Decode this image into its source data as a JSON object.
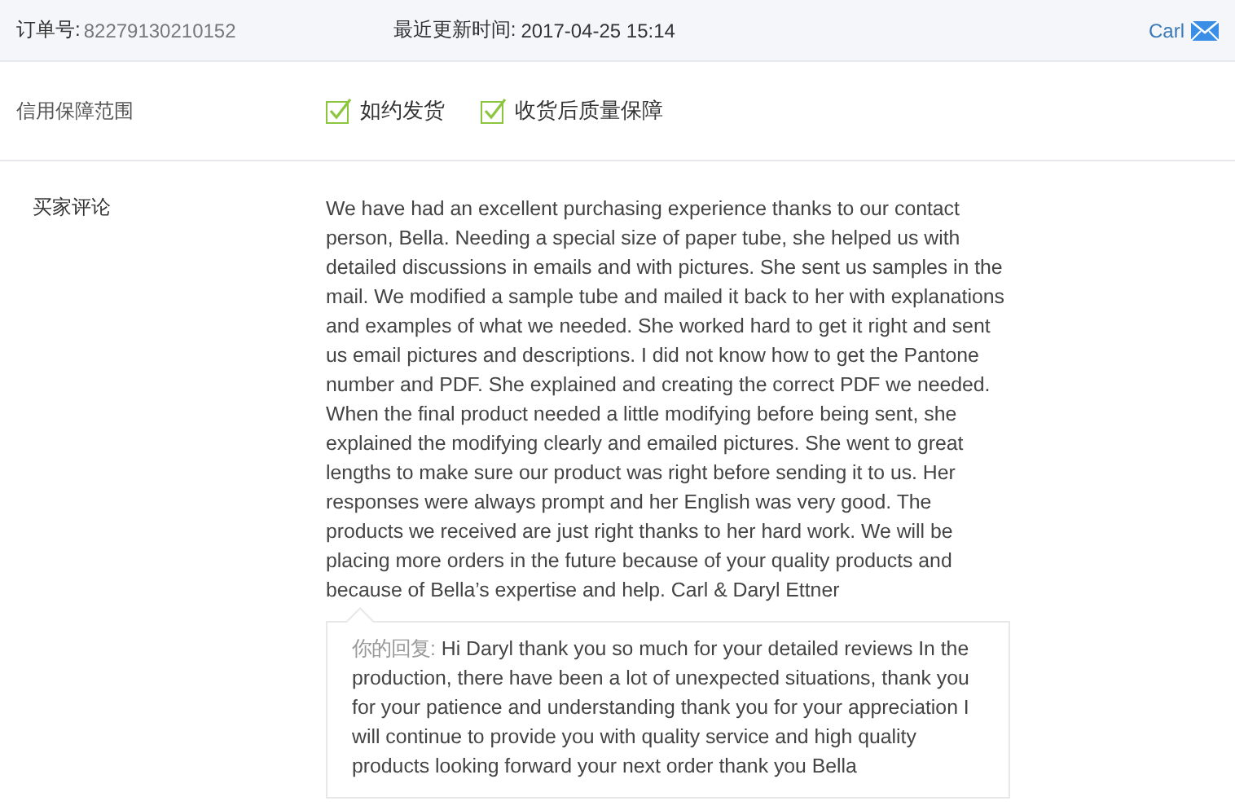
{
  "order_bar": {
    "order_label": "订单号:",
    "order_number": "82279130210152",
    "updated_label": "最近更新时间:",
    "updated_time": "2017-04-25 15:14",
    "contact": "Carl"
  },
  "guarantee": {
    "label": "信用保障范围",
    "items": [
      {
        "label": "如约发货",
        "checked": true
      },
      {
        "label": "收货后质量保障",
        "checked": true
      }
    ]
  },
  "review": {
    "label": "买家评论",
    "text": "We have had an excellent purchasing experience thanks to our contact person, Bella. Needing a special size of paper tube, she helped us with detailed discussions in emails and with pictures. She sent us samples in the mail. We modified a sample tube and mailed it back to her with explanations and examples of what we needed. She worked hard to get it right and sent us email pictures and descriptions. I did not know how to get the Pantone number and PDF. She explained and creating the correct PDF we needed. When the final product needed a little modifying before being sent, she explained the modifying clearly and emailed pictures. She went to great lengths to make sure our product was right before sending it to us. Her responses were always prompt and her English was very good. The products we received are just right thanks to her hard work. We will be placing more orders in the future because of your quality products and because of Bella’s expertise and help. Carl & Daryl Ettner",
    "reply_label": "你的回复:",
    "reply_text": "Hi Daryl thank you so much for your detailed reviews In the production, there have been a lot of unexpected situations, thank you for your patience and understanding thank you for your appreciation I will continue to provide you with quality service and high quality products looking forward your next order thank you Bella"
  }
}
